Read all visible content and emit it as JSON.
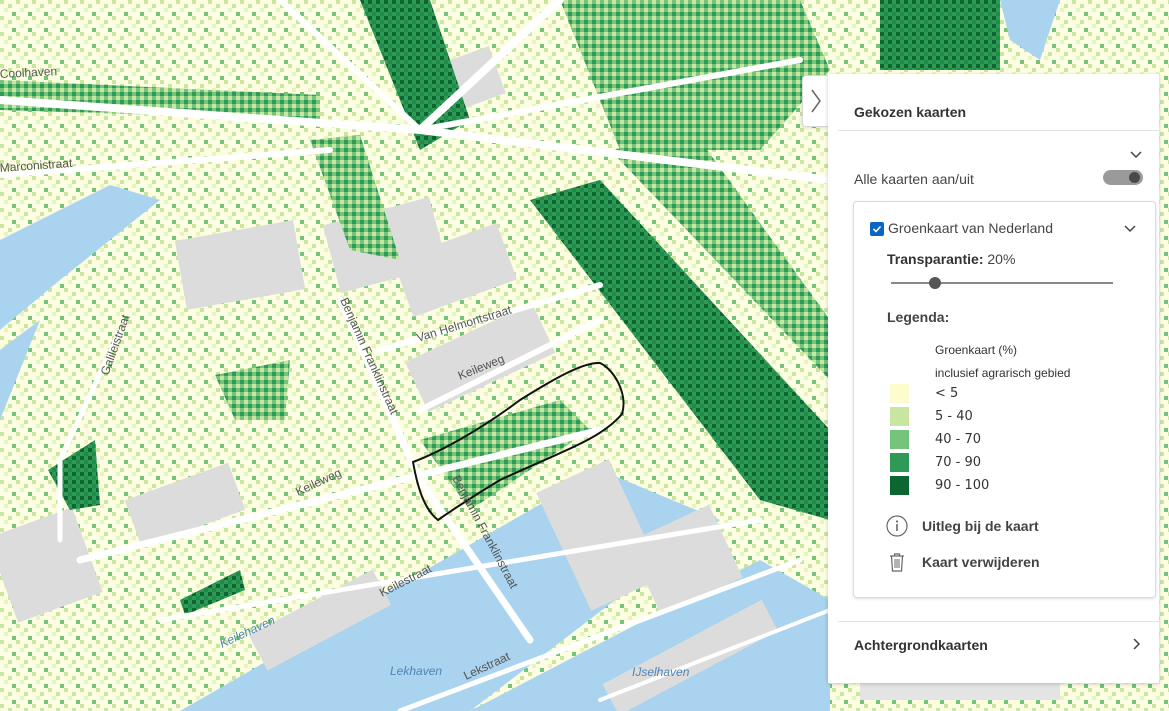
{
  "map": {
    "street_labels": [
      {
        "text": "Keileweg",
        "id": "keileweg-1"
      },
      {
        "text": "Keileweg",
        "id": "keileweg-2"
      },
      {
        "text": "Van Helmontstraat",
        "id": "van-helmontstraat"
      },
      {
        "text": "Benjamin Franklinstraat",
        "id": "benjamin-franklinstraat-1"
      },
      {
        "text": "Benjamin Franklinstraat",
        "id": "benjamin-franklinstraat-2"
      },
      {
        "text": "Keilestraat",
        "id": "keilestraat"
      },
      {
        "text": "Lekstraat",
        "id": "lekstraat"
      },
      {
        "text": "Galileistraat",
        "id": "galileistraat"
      },
      {
        "text": "Marconistraat",
        "id": "marconistraat"
      },
      {
        "text": "Coolhaven",
        "id": "coolhaven"
      }
    ],
    "water_labels": [
      {
        "text": "Keilehaven",
        "id": "keilehaven"
      },
      {
        "text": "Lekhaven",
        "id": "lekhaven"
      },
      {
        "text": "IJselhaven",
        "id": "ijselhaven"
      }
    ],
    "colors": {
      "water": "#a9d3ee",
      "building": "#dcdcdc",
      "road": "#ffffff",
      "outline": "#111111"
    }
  },
  "panel": {
    "title": "Gekozen kaarten",
    "toggle_all_label": "Alle kaarten aan/uit",
    "toggle_all_on": true,
    "layer": {
      "name": "Groenkaart van Nederland",
      "checked": true,
      "transparency_label": "Transparantie:",
      "transparency_value": "20%",
      "transparency_fraction": 0.2,
      "legend_title": "Legenda:",
      "legend_heading_1": "Groenkaart (%)",
      "legend_heading_2": "inclusief agrarisch gebied",
      "legend_items": [
        {
          "label": "< 5",
          "color": "#fcfccc"
        },
        {
          "label": "5 - 40",
          "color": "#c9e6a1"
        },
        {
          "label": "40 - 70",
          "color": "#74c47c"
        },
        {
          "label": "70 - 90",
          "color": "#2f9a55"
        },
        {
          "label": "90 - 100",
          "color": "#0b6632"
        }
      ],
      "info_label": "Uitleg bij de kaart",
      "delete_label": "Kaart verwijderen",
      "info_icon": "info-icon",
      "delete_icon": "trash-icon"
    },
    "background_maps_label": "Achtergrondkaarten"
  }
}
